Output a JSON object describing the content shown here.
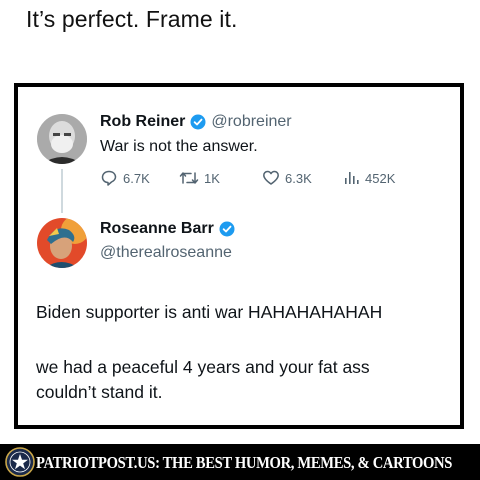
{
  "caption": "It’s perfect. Frame it.",
  "tweet1": {
    "name": "Rob Reiner",
    "handle": "@robreiner",
    "text": "War is not the answer.",
    "verified": true,
    "metrics": {
      "replies": "6.7K",
      "retweets": "1K",
      "likes": "6.3K",
      "views": "452K"
    }
  },
  "tweet2": {
    "name": "Roseanne Barr",
    "handle": "@therealroseanne",
    "verified": true,
    "lines": [
      "Biden supporter is anti war HAHAHAHAHAH",
      "we had a peaceful 4 years and your fat ass",
      "couldn’t stand it."
    ]
  },
  "footer": {
    "text": "PATRIOTPOST.US: THE BEST HUMOR, MEMES, & CARTOONS"
  },
  "colors": {
    "verified_badge": "#1d9bf0",
    "muted_text": "#536471",
    "frame_border": "#000000",
    "banner_bg": "#000000"
  },
  "icons": [
    "reply-icon",
    "retweet-icon",
    "like-icon",
    "views-icon",
    "verified-badge-icon",
    "patriot-seal-icon"
  ]
}
